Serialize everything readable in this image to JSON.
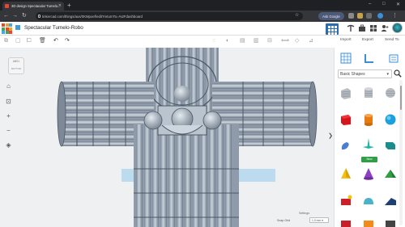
{
  "browser": {
    "tab_title": "3D design Spectacular Tumelo...",
    "new_tab": "+",
    "url": "tinkercad.com/things/aus/0KMpoef/edit?returnTo=%2Fdashboard",
    "ask_google": "Ask Google",
    "window_controls": [
      "–",
      "□",
      "✕"
    ],
    "tab_close": "✕"
  },
  "app": {
    "design_name": "Spectacular Tumelo-Robo",
    "accent_color": "#2b6cb0",
    "right_header_labels": [
      "Import",
      "Export",
      "Send To"
    ]
  },
  "viewcube": {
    "face": "ABS1",
    "sub": "BOTTOM"
  },
  "panel": {
    "shape_library": "Basic Shapes",
    "new_badge": "New",
    "collapse_glyph": "❯"
  },
  "footer": {
    "settings": "Settings",
    "snap_grid_label": "Snap Grid",
    "snap_grid_value": "1.0 mm ▾"
  }
}
